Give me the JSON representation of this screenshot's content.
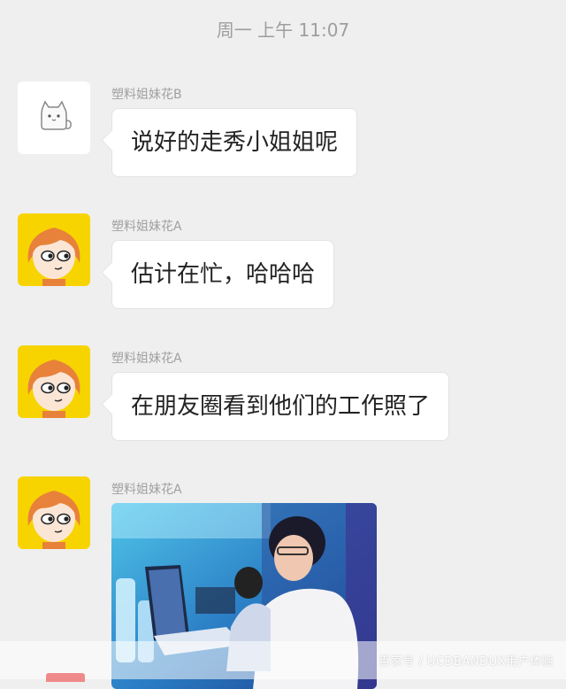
{
  "chat": {
    "timestamp": "周一 上午 11:07",
    "messages": [
      {
        "sender": "塑料姐妹花B",
        "avatar": "cat-icon-avatar",
        "text": "说好的走秀小姐姐呢"
      },
      {
        "sender": "塑料姐妹花A",
        "avatar": "cartoon-girl-avatar",
        "text": "估计在忙，哈哈哈"
      },
      {
        "sender": "塑料姐妹花A",
        "avatar": "cartoon-girl-avatar",
        "text": "在朋友圈看到他们的工作照了"
      },
      {
        "sender": "塑料姐妹花A",
        "avatar": "cartoon-girl-avatar",
        "image": "photo of people working at laptops"
      }
    ]
  },
  "watermark": "百家号 / UCDBANDUX用户体验",
  "colors": {
    "background": "#efefef",
    "avatar_yellow": "#f7d400",
    "bubble": "#ffffff"
  }
}
